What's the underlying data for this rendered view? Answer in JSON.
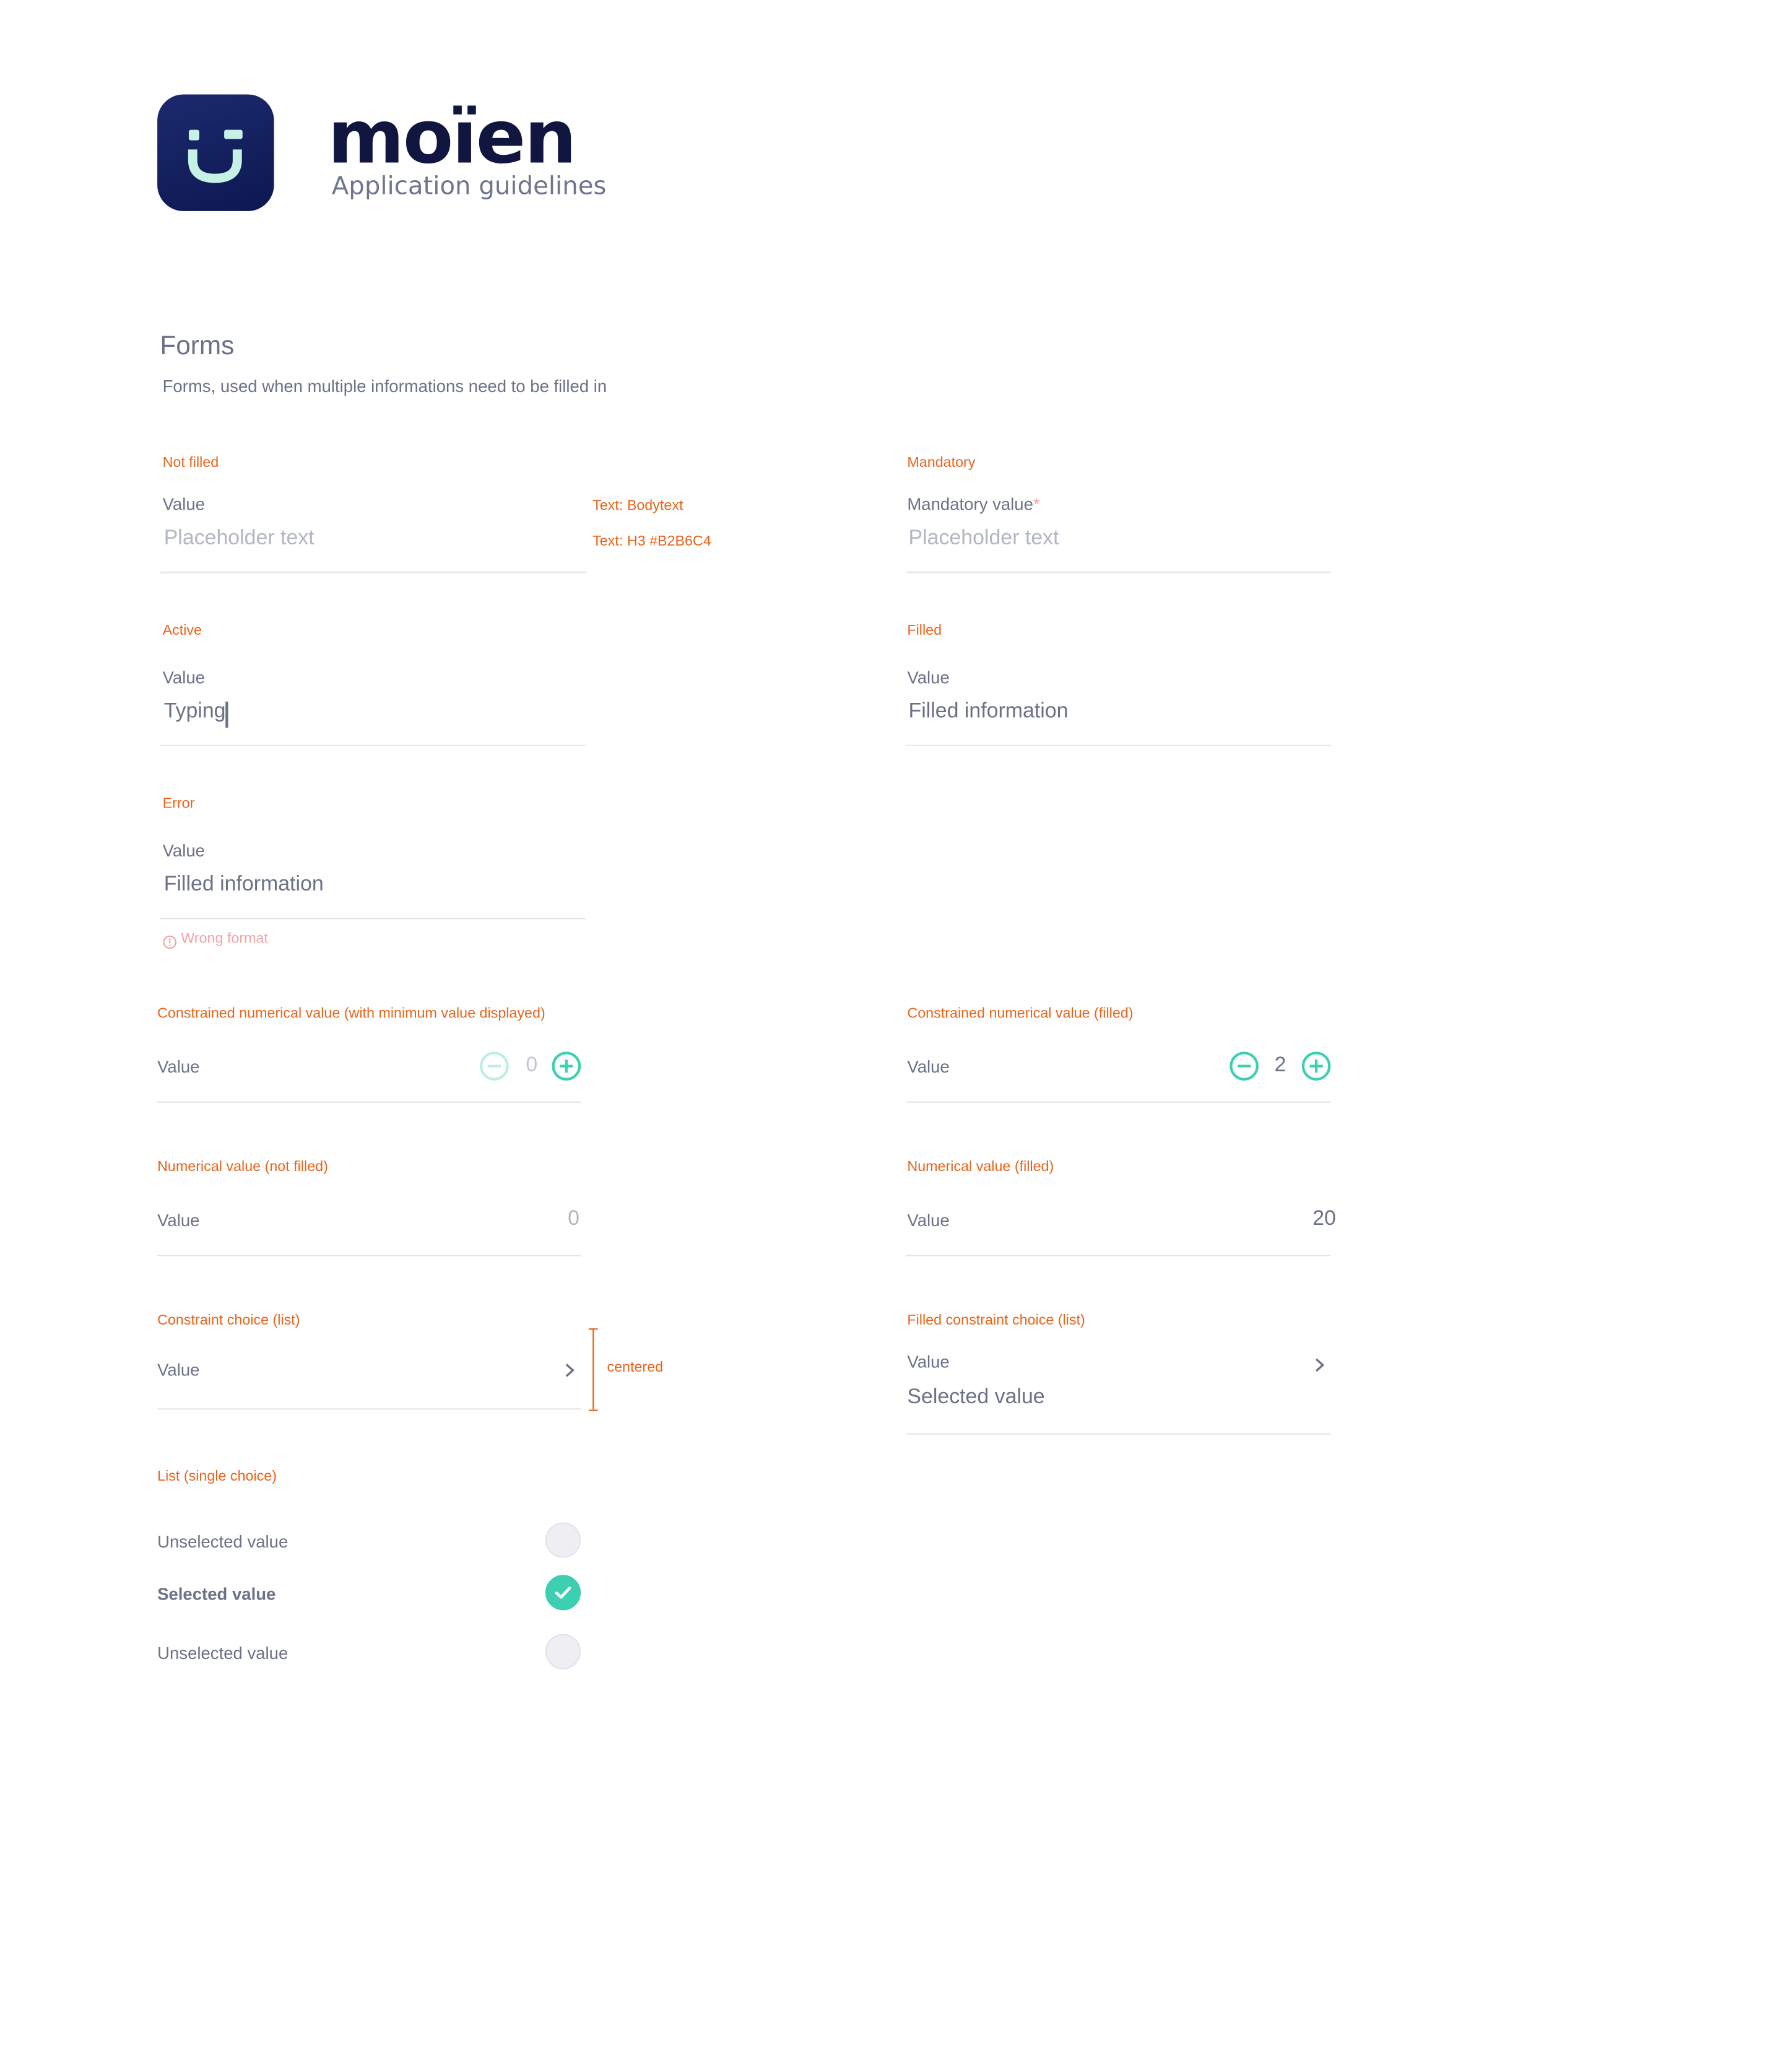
{
  "header": {
    "brand": "moïen",
    "subtitle": "Application guidelines",
    "icon": "smiley-app-icon"
  },
  "section": {
    "title": "Forms",
    "description": "Forms, used when multiple informations need to be filled in"
  },
  "annotations": {
    "bodytext": "Text: Bodytext",
    "h3": "Text: H3 #B2B6C4",
    "centered": "centered"
  },
  "states": {
    "not_filled": {
      "note": "Not filled",
      "label": "Value",
      "placeholder": "Placeholder text"
    },
    "mandatory": {
      "note": "Mandatory",
      "label": "Mandatory value",
      "asterisk": "*",
      "placeholder": "Placeholder text"
    },
    "active": {
      "note": "Active",
      "label": "Value",
      "value": "Typing"
    },
    "filled": {
      "note": "Filled",
      "label": "Value",
      "value": "Filled information"
    },
    "error": {
      "note": "Error",
      "label": "Value",
      "value": "Filled information",
      "error_icon": "info-circle-icon",
      "error_text": "Wrong format"
    }
  },
  "steppers": {
    "min": {
      "note": "Constrained numerical value (with minimum value displayed)",
      "label": "Value",
      "value": "0"
    },
    "filled": {
      "note": "Constrained numerical value (filled)",
      "label": "Value",
      "value": "2"
    }
  },
  "numerics": {
    "not_filled": {
      "note": "Numerical value (not filled)",
      "label": "Value",
      "value": "0"
    },
    "filled": {
      "note": "Numerical value (filled)",
      "label": "Value",
      "value": "20"
    }
  },
  "choices": {
    "constraint": {
      "note": "Constraint choice (list)",
      "label": "Value"
    },
    "filled": {
      "note": "Filled constraint choice (list)",
      "label": "Value",
      "value": "Selected value"
    }
  },
  "list": {
    "note": "List (single choice)",
    "items": [
      {
        "label": "Unselected value",
        "selected": false
      },
      {
        "label": "Selected value",
        "selected": true
      },
      {
        "label": "Unselected value",
        "selected": false
      }
    ]
  },
  "colors": {
    "accent": "#3CCFB1",
    "annotation": "#E8641B",
    "placeholder": "#B2B6C4",
    "text": "#6B7187",
    "brand_navy": "#101640",
    "error": "#F4A3A3"
  }
}
